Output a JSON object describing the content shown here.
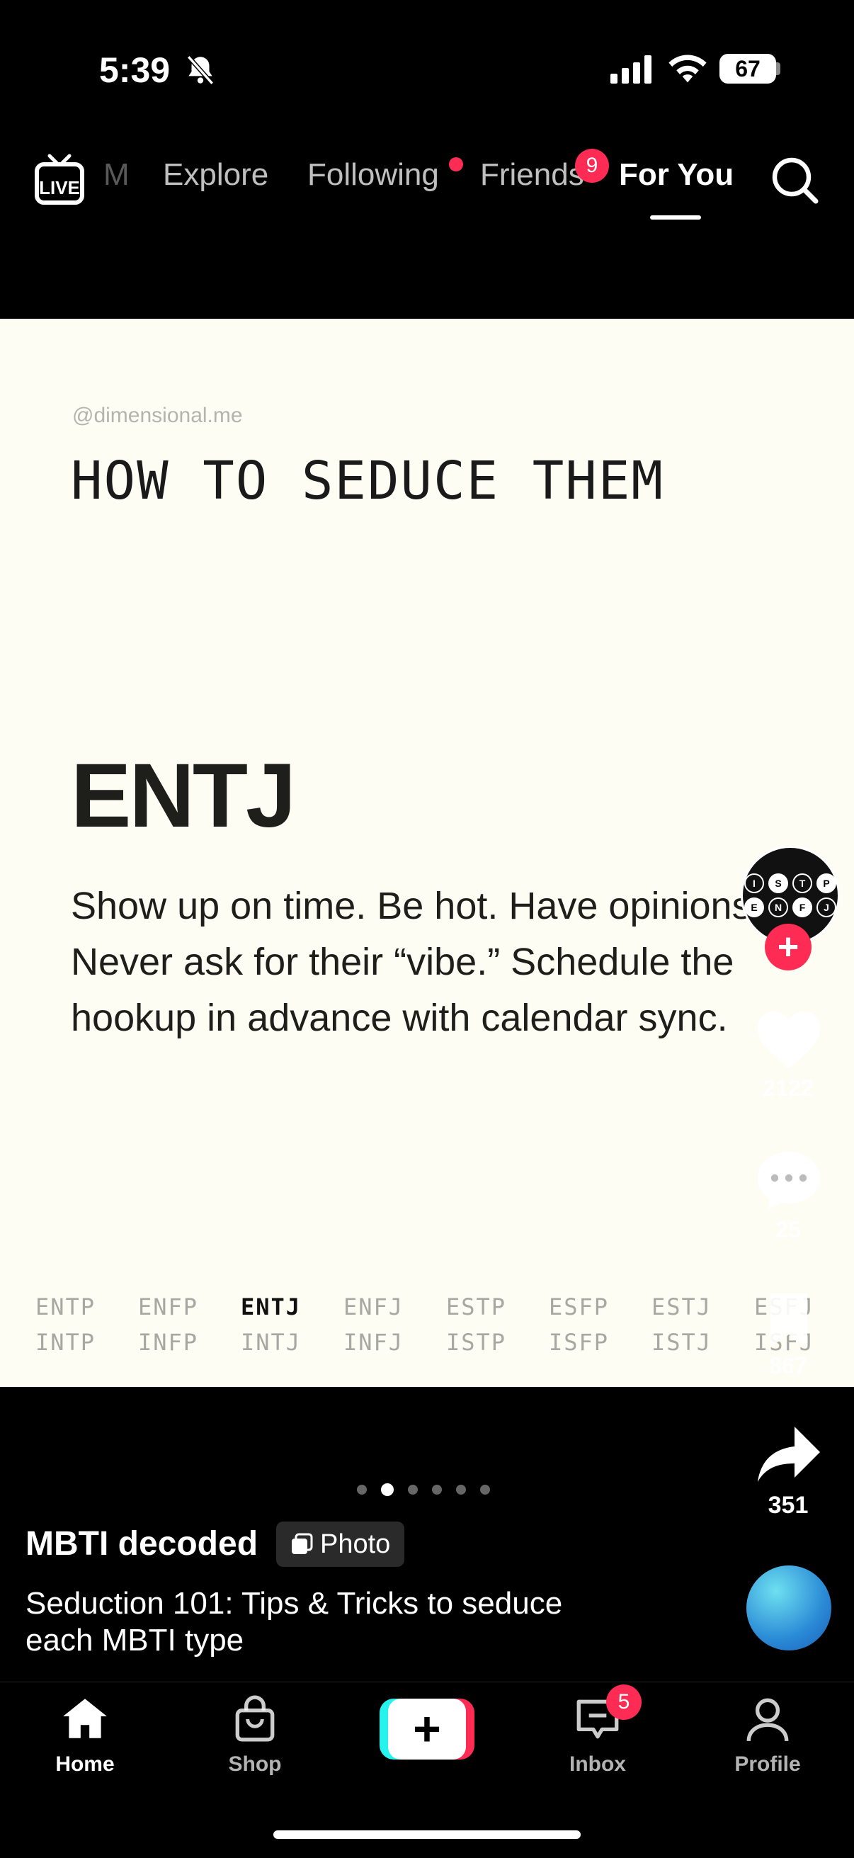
{
  "status_bar": {
    "time": "5:39",
    "battery": "67"
  },
  "top_nav": {
    "live_label": "LIVE",
    "tabs": [
      {
        "label": "M"
      },
      {
        "label": "Explore"
      },
      {
        "label": "Following"
      },
      {
        "label": "Friends"
      },
      {
        "label": "For You"
      }
    ],
    "friends_badge": "9",
    "active_tab": "For You"
  },
  "post": {
    "handle": "@dimensional.me",
    "headline": "HOW TO SEDUCE THEM",
    "type": "ENTJ",
    "advice": "Show up on time. Be hot. Have opinions. Never ask for their “vibe.” Schedule the hookup in advance with calendar sync.",
    "mbti_top": [
      "ENTP",
      "ENFP",
      "ENTJ",
      "ENFJ",
      "ESTP",
      "ESFP",
      "ESTJ",
      "ESFJ"
    ],
    "mbti_bottom": [
      "INTP",
      "INFP",
      "INTJ",
      "INFJ",
      "ISTP",
      "ISFP",
      "ISTJ",
      "ISFJ"
    ],
    "selected_type": "ENTJ",
    "avatar_letters": [
      "I",
      "S",
      "T",
      "P",
      "E",
      "N",
      "F",
      "J"
    ]
  },
  "actions": {
    "likes": "2122",
    "comments": "25",
    "saves": "867",
    "shares": "351"
  },
  "pager": {
    "count": 6,
    "active": 1
  },
  "caption": {
    "author": "MBTI decoded",
    "tag": "Photo",
    "text": "Seduction 101: Tips & Tricks to seduce each MBTI type"
  },
  "bottom_nav": {
    "home": "Home",
    "shop": "Shop",
    "inbox": "Inbox",
    "profile": "Profile",
    "inbox_badge": "5",
    "active": "Home"
  },
  "colors": {
    "accent": "#fe2c55",
    "cyan": "#25f4ee",
    "card_bg": "#fdfdf4"
  }
}
